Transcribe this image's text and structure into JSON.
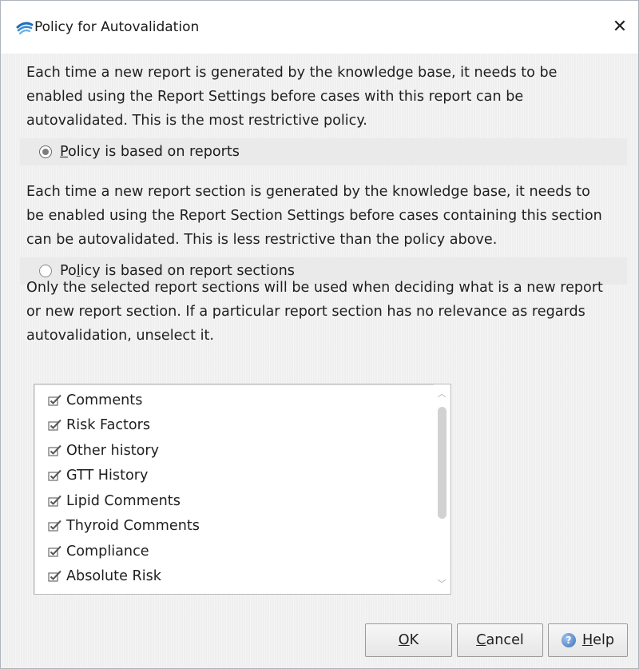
{
  "window": {
    "title": "Policy for Autovalidation",
    "close_icon": "close-icon",
    "app_icon": "app-logo-icon"
  },
  "paragraphs": {
    "reports_policy": [
      "Each time a new report is generated by the knowledge base, it needs to be",
      "enabled using the Report Settings before cases with this report can be",
      "autovalidated. This is the most restrictive policy."
    ],
    "sections_policy": [
      "Each time a new report section is generated by the knowledge base, it needs to",
      "be enabled using the Report Section Settings before cases containing this section",
      "can be autovalidated. This is less restrictive than the policy above."
    ],
    "selection_note": [
      "Only the selected report sections will be used when deciding what is a new report",
      "or new report section. If a particular report section has no relevance as regards",
      "autovalidation, unselect it."
    ]
  },
  "radios": {
    "reports": {
      "mnemonic": "P",
      "rest": "olicy is based on reports",
      "checked": true
    },
    "sections": {
      "before": "Po",
      "mnemonic": "l",
      "rest": "icy is based on report sections",
      "checked": false
    }
  },
  "sections_list": {
    "items": [
      {
        "label": "Comments",
        "checked": true
      },
      {
        "label": "Risk Factors",
        "checked": true
      },
      {
        "label": "Other history",
        "checked": true
      },
      {
        "label": "GTT History",
        "checked": true
      },
      {
        "label": "Lipid Comments",
        "checked": true
      },
      {
        "label": "Thyroid Comments",
        "checked": true
      },
      {
        "label": "Compliance",
        "checked": true
      },
      {
        "label": "Absolute Risk",
        "checked": true
      }
    ],
    "scroll_up_icon": "chevron-up-icon",
    "scroll_down_icon": "chevron-down-icon"
  },
  "buttons": {
    "ok": {
      "mnemonic": "O",
      "rest": "K"
    },
    "cancel": {
      "mnemonic": "C",
      "rest": "ancel"
    },
    "help": {
      "mnemonic": "H",
      "rest": "elp",
      "icon": "help-icon"
    }
  },
  "colors": {
    "window_bg": "#efefef",
    "titlebar_bg": "#ffffff",
    "help_icon_blue": "#3b6fb8",
    "logo_blue": "#2f7fc8"
  }
}
